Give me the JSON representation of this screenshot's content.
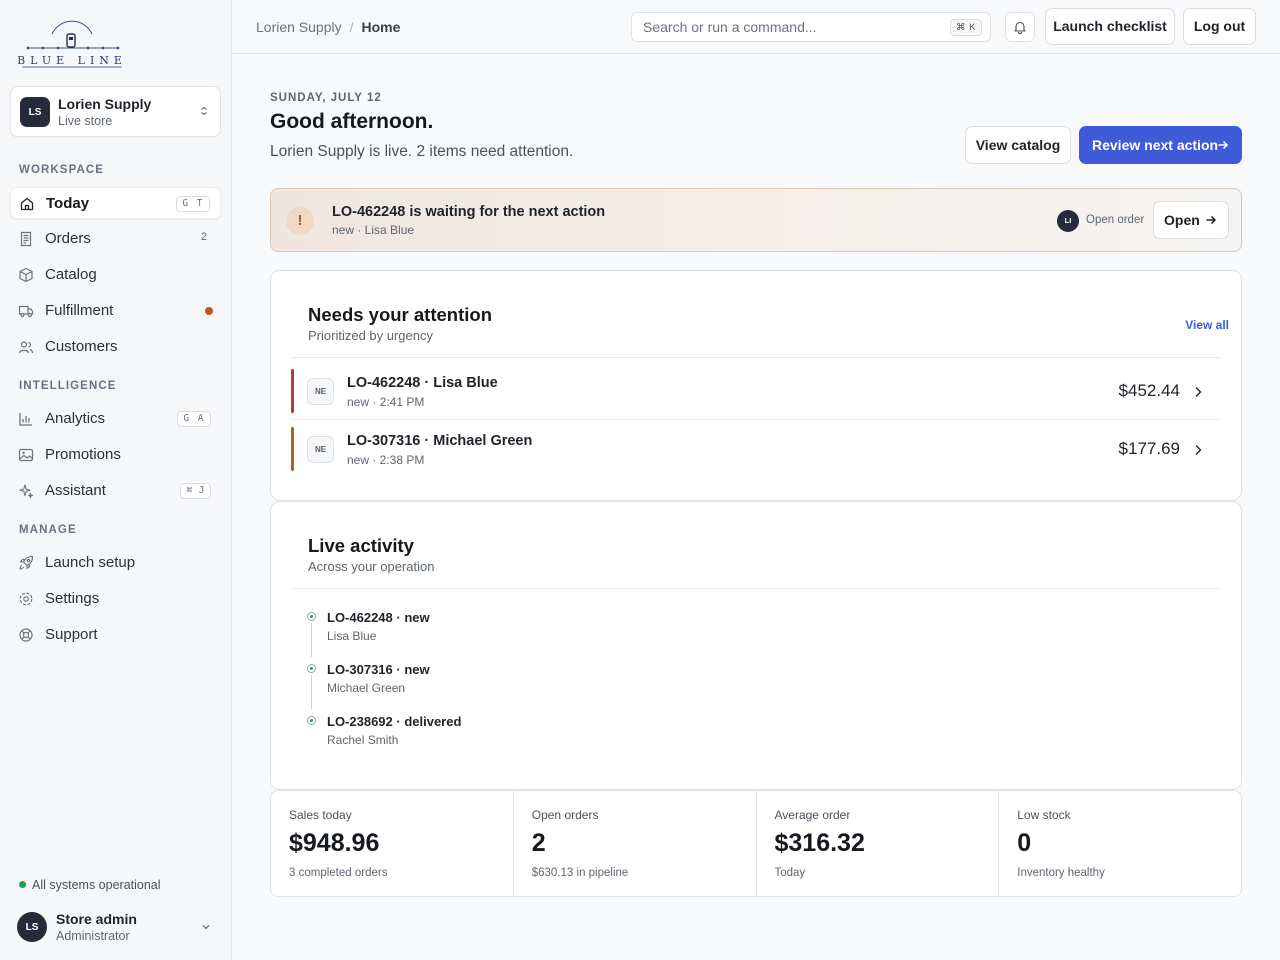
{
  "brand": {
    "logo_text": "BLUE LINE"
  },
  "store": {
    "initials": "LS",
    "name": "Lorien Supply",
    "status": "Live store"
  },
  "nav": {
    "sections": [
      {
        "label": "WORKSPACE"
      },
      {
        "label": "INTELLIGENCE"
      },
      {
        "label": "MANAGE"
      }
    ],
    "items": [
      {
        "label": "Today",
        "icon": "home-icon",
        "shortcut": "G T",
        "active": true
      },
      {
        "label": "Orders",
        "icon": "receipt-icon",
        "count": "2"
      },
      {
        "label": "Catalog",
        "icon": "box-icon"
      },
      {
        "label": "Fulfillment",
        "icon": "truck-icon",
        "dot": true
      },
      {
        "label": "Customers",
        "icon": "users-icon"
      },
      {
        "label": "Analytics",
        "icon": "bar-chart-icon",
        "shortcut": "G A"
      },
      {
        "label": "Promotions",
        "icon": "image-icon"
      },
      {
        "label": "Assistant",
        "icon": "sparkle-icon",
        "shortcut": "⌘ J"
      },
      {
        "label": "Launch setup",
        "icon": "rocket-icon"
      },
      {
        "label": "Settings",
        "icon": "gear-icon"
      },
      {
        "label": "Support",
        "icon": "lifebuoy-icon"
      }
    ]
  },
  "system_status": "All systems operational",
  "user": {
    "initials": "LS",
    "name": "Store admin",
    "role": "Administrator"
  },
  "topbar": {
    "breadcrumb": [
      "Lorien Supply",
      "Home"
    ],
    "search_placeholder": "Search or run a command...",
    "search_shortcut": "⌘ K",
    "launch_checklist": "Launch checklist",
    "logout": "Log out"
  },
  "header": {
    "date": "SUNDAY, JULY 12",
    "greeting": "Good afternoon.",
    "subtitle": "Lorien Supply is live. 2 items need attention.",
    "view_catalog": "View catalog",
    "review_next": "Review next action"
  },
  "alert": {
    "title": "LO-462248 is waiting for the next action",
    "sub": "new · Lisa Blue",
    "avatar": "LI",
    "meta": "Open order",
    "button": "Open"
  },
  "attention": {
    "title": "Needs your attention",
    "subtitle": "Prioritized by urgency",
    "view_all": "View all",
    "rows": [
      {
        "chip": "NE",
        "title": "LO-462248 · Lisa Blue",
        "sub": "new · 2:41 PM",
        "amount": "$452.44",
        "color": "#b23a3a"
      },
      {
        "chip": "NE",
        "title": "LO-307316 · Michael Green",
        "sub": "new · 2:38 PM",
        "amount": "$177.69",
        "color": "#a8641f"
      }
    ]
  },
  "activity": {
    "title": "Live activity",
    "subtitle": "Across your operation",
    "items": [
      {
        "title": "LO-462248 · new",
        "sub": "Lisa Blue"
      },
      {
        "title": "LO-307316 · new",
        "sub": "Michael Green"
      },
      {
        "title": "LO-238692 · delivered",
        "sub": "Rachel Smith"
      }
    ]
  },
  "stats": [
    {
      "label": "Sales today",
      "value": "$948.96",
      "sub": "3 completed orders"
    },
    {
      "label": "Open orders",
      "value": "2",
      "sub": "$630.13 in pipeline"
    },
    {
      "label": "Average order",
      "value": "$316.32",
      "sub": "Today"
    },
    {
      "label": "Low stock",
      "value": "0",
      "sub": "Inventory healthy"
    }
  ]
}
